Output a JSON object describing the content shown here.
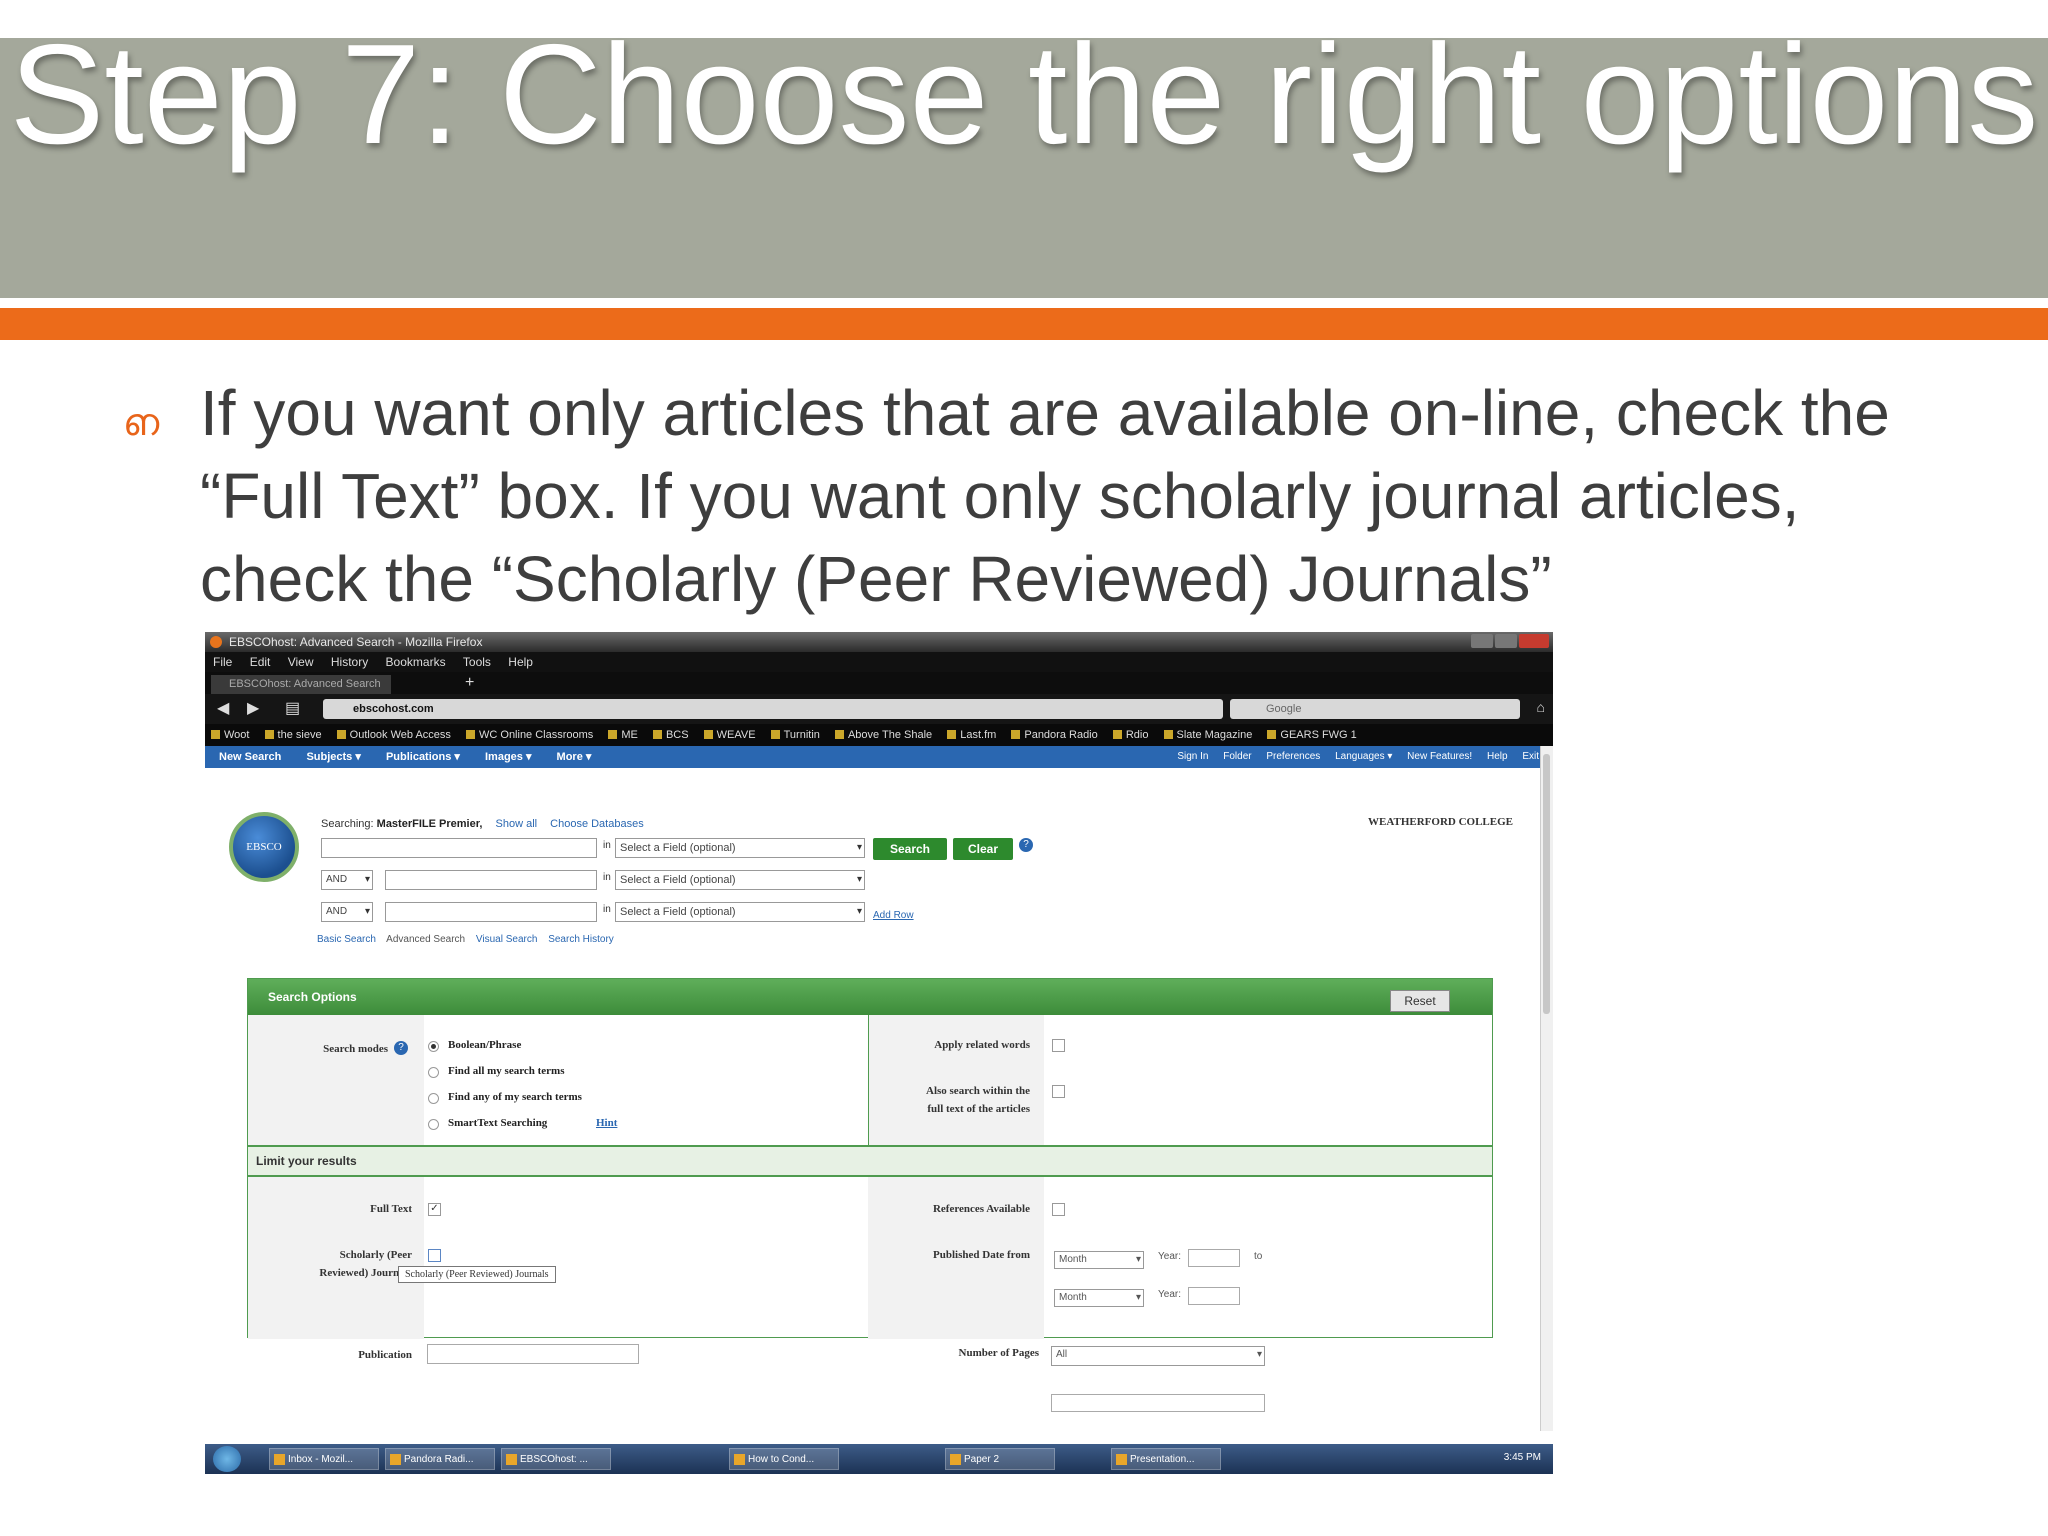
{
  "slide": {
    "title": "Step 7: Choose the right options",
    "bullet_symbol": "ഩ",
    "bullet_text": "If you want only articles that are available on-line, check the “Full Text” box. If you want only scholarly journal articles, check the “Scholarly (Peer Reviewed) Journals”",
    "colors": {
      "banner": "#a4a89b",
      "accent": "#ec6b1a",
      "bullet": "#e8641a"
    }
  },
  "browser": {
    "window_title": "EBSCOhost: Advanced Search - Mozilla Firefox",
    "menu": [
      "File",
      "Edit",
      "View",
      "History",
      "Bookmarks",
      "Tools",
      "Help"
    ],
    "tab_title": "EBSCOhost: Advanced Search",
    "url": "ebscohost.com",
    "search_placeholder": "Google",
    "bookmarks": [
      "Woot",
      "the sieve",
      "Outlook Web Access",
      "WC Online Classrooms",
      "ME",
      "BCS",
      "WEAVE",
      "Turnitin",
      "Above The Shale",
      "Last.fm",
      "Pandora Radio",
      "Rdio",
      "Slate Magazine",
      "GEARS FWG 1"
    ]
  },
  "ebsco": {
    "topnav": [
      "New Search",
      "Subjects ▾",
      "Publications ▾",
      "Images ▾",
      "More ▾"
    ],
    "topright": [
      "Sign In",
      "Folder",
      "Preferences",
      "Languages ▾",
      "New Features!",
      "Help",
      "Exit"
    ],
    "logo_text": "EBSCO",
    "searching_label": "Searching:",
    "database": "MasterFILE Premier,",
    "show_all": "Show all",
    "choose_databases": "Choose Databases",
    "institution": "WEATHERFORD COLLEGE",
    "in_label": "in",
    "field_placeholder": "Select a Field (optional)",
    "bool_op": "AND",
    "search_btn": "Search",
    "clear_btn": "Clear",
    "add_row": "Add Row",
    "search_links": [
      "Basic Search",
      "Advanced Search",
      "Visual Search",
      "Search History"
    ],
    "options_title": "Search Options",
    "reset": "Reset",
    "search_modes_label": "Search modes",
    "modes": [
      "Boolean/Phrase",
      "Find all my search terms",
      "Find any of my search terms",
      "SmartText Searching"
    ],
    "hint": "Hint",
    "apply_related": "Apply related words",
    "also_search_1": "Also search within the",
    "also_search_2": "full text of the articles",
    "limit_title": "Limit your results",
    "full_text": "Full Text",
    "scholarly_1": "Scholarly (Peer",
    "scholarly_2": "Reviewed) Journals",
    "scholarly_tooltip": "Scholarly (Peer Reviewed) Journals",
    "publication": "Publication",
    "references": "References Available",
    "published_date": "Published Date from",
    "month": "Month",
    "year": "Year:",
    "to": "to",
    "pages_label": "Number of Pages",
    "pages_value": "All"
  },
  "taskbar": {
    "items": [
      "Inbox - Mozil...",
      "Pandora Radi...",
      "EBSCOhost: ...",
      "How to Cond...",
      "Paper 2",
      "Presentation..."
    ],
    "time": "3:45 PM"
  }
}
